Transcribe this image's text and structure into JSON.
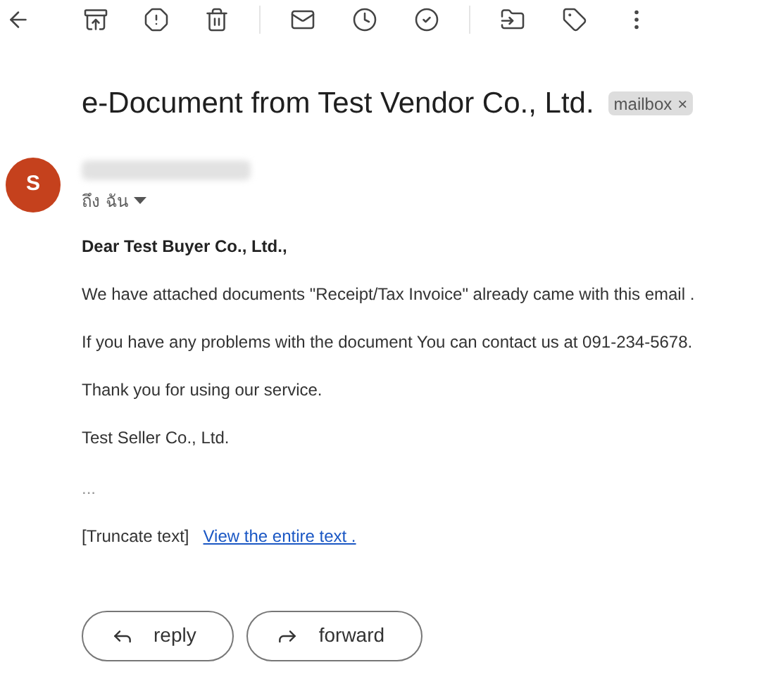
{
  "subject": {
    "title": "e-Document from Test Vendor Co., Ltd.",
    "label": "mailbox",
    "label_remove": "×"
  },
  "sender": {
    "avatar_letter": "S",
    "recipient": "ถึง ฉัน"
  },
  "body": {
    "greeting": "Dear Test Buyer Co., Ltd.,",
    "paragraphs": [
      "We have attached documents \"Receipt/Tax Invoice\" already came with this email .",
      "If you have any problems with the document You can contact us at 091-234-5678.",
      "Thank you for using our service.",
      "Test Seller Co., Ltd."
    ],
    "ellipsis": "...",
    "truncate_note": "[Truncate text]",
    "view_link": "View the entire text ."
  },
  "actions": [
    {
      "kind": "reply",
      "label": "reply"
    },
    {
      "kind": "forward",
      "label": "forward"
    }
  ]
}
